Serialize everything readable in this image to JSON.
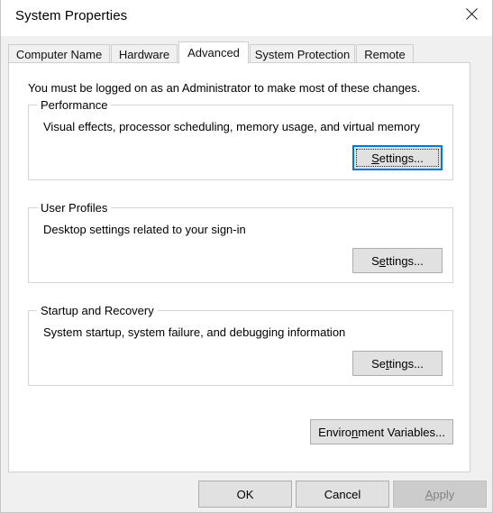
{
  "window": {
    "title": "System Properties",
    "close_icon": "close-icon"
  },
  "tabs": [
    {
      "label": "Computer Name",
      "selected": false
    },
    {
      "label": "Hardware",
      "selected": false
    },
    {
      "label": "Advanced",
      "selected": true
    },
    {
      "label": "System Protection",
      "selected": false
    },
    {
      "label": "Remote",
      "selected": false
    }
  ],
  "panel": {
    "admin_note": "You must be logged on as an Administrator to make most of these changes.",
    "groups": [
      {
        "legend": "Performance",
        "description": "Visual effects, processor scheduling, memory usage, and virtual memory",
        "button": {
          "label": "Settings...",
          "accel_before": "",
          "accel_char": "S",
          "accel_after": "ettings...",
          "focused": true,
          "enabled": true
        }
      },
      {
        "legend": "User Profiles",
        "description": "Desktop settings related to your sign-in",
        "button": {
          "label": "Settings...",
          "accel_before": "S",
          "accel_char": "e",
          "accel_after": "ttings...",
          "focused": false,
          "enabled": true
        }
      },
      {
        "legend": "Startup and Recovery",
        "description": "System startup, system failure, and debugging information",
        "button": {
          "label": "Settings...",
          "accel_before": "Se",
          "accel_char": "t",
          "accel_after": "tings...",
          "focused": false,
          "enabled": true
        }
      }
    ],
    "env_button": {
      "label": "Environment Variables...",
      "accel_before": "Enviro",
      "accel_char": "n",
      "accel_after": "ment Variables..."
    }
  },
  "footer": {
    "ok": {
      "label": "OK",
      "enabled": true
    },
    "cancel": {
      "label": "Cancel",
      "enabled": true
    },
    "apply": {
      "label": "Apply",
      "accel_before": "",
      "accel_char": "A",
      "accel_after": "pply",
      "enabled": false
    }
  },
  "colors": {
    "focus_border": "#0078d7",
    "window_bg": "#f0f0f0",
    "panel_bg": "#ffffff",
    "button_face": "#e1e1e1",
    "disabled_text": "#838383"
  }
}
